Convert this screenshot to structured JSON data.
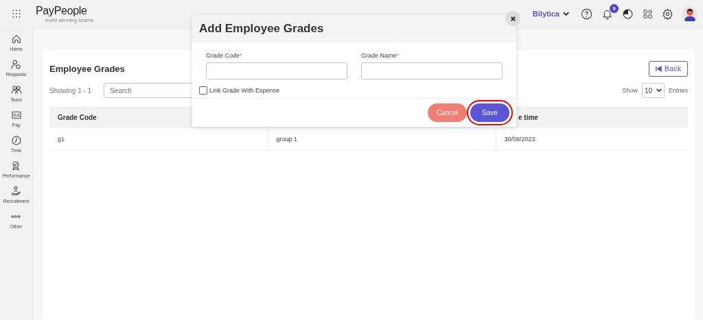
{
  "top_bar": {
    "logo": "PayPeople",
    "tagline": "build winning teams",
    "company": "Bilytica",
    "notification_count": "9"
  },
  "sidebar": {
    "items": [
      {
        "label": "Home"
      },
      {
        "label": "Requests"
      },
      {
        "label": "Team"
      },
      {
        "label": "Pay"
      },
      {
        "label": "Time"
      },
      {
        "label": "Performance"
      },
      {
        "label": "Recruitment"
      },
      {
        "label": "Other"
      }
    ]
  },
  "page": {
    "title": "Employee Grades",
    "back_button": "Back",
    "showing": "Showing 1 - 1",
    "search": {
      "placeholder": "Search"
    },
    "show_label": "Show",
    "page_size": "10",
    "entries_label": "Entries",
    "table": {
      "header": {
        "column_1": "Grade Code",
        "column_3": "e time"
      },
      "rows": [
        [
          "g1",
          "group 1",
          "30/08/2023"
        ]
      ]
    }
  },
  "modal": {
    "title": "Add Employee Grades",
    "fields": [
      {
        "label": "Grade Code",
        "mark": "*"
      },
      {
        "label": "Grade Name",
        "mark": "*"
      }
    ],
    "checkbox": {
      "label": "Link Grade With Expense",
      "checked": false
    },
    "buttons": [
      {
        "label": "Cancel",
        "kind": "cancel",
        "highlighted": false
      },
      {
        "label": "Save",
        "kind": "save",
        "highlighted": true
      }
    ]
  }
}
